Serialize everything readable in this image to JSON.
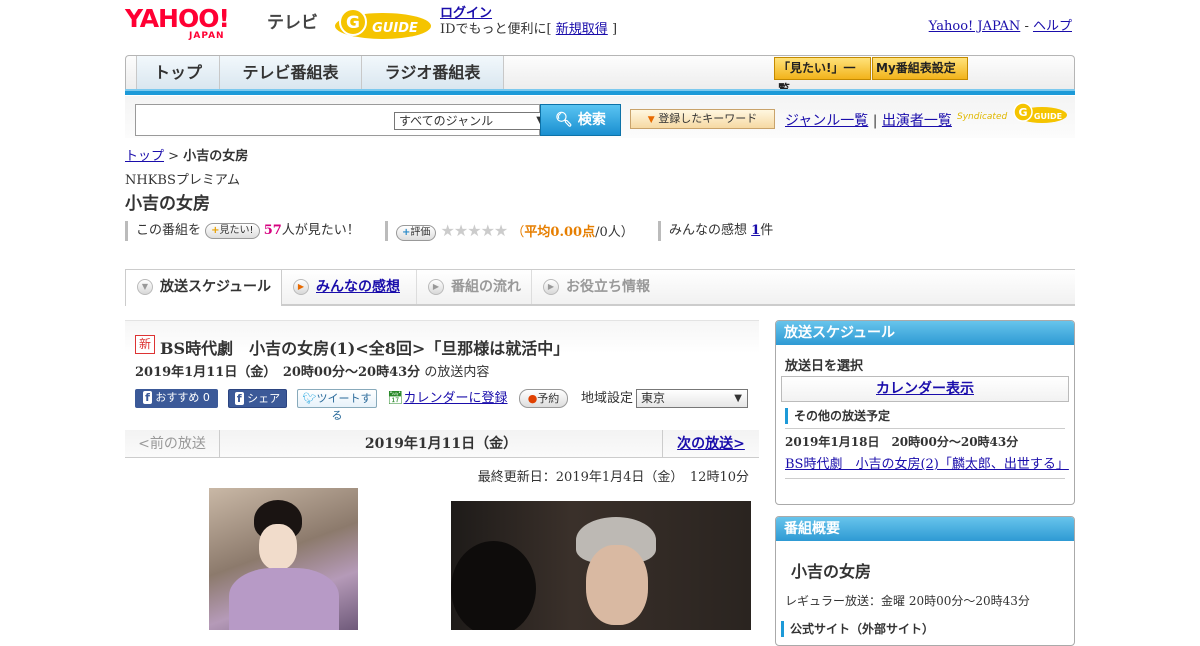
{
  "header": {
    "logo_main": "YAHOO!",
    "logo_sub": "JAPAN",
    "logo_tv": "テレビ",
    "gguide_logo": "G GUIDE",
    "login_link": "ログイン",
    "login_text": "IDでもっと便利に[",
    "register_link": "新規取得",
    "login_close": "]",
    "yj_link": "Yahoo! JAPAN",
    "sep": "-",
    "help_link": "ヘルプ"
  },
  "nav": {
    "tabs": [
      {
        "label": "トップ"
      },
      {
        "label": "テレビ番組表"
      },
      {
        "label": "ラジオ番組表"
      }
    ],
    "mitai_list": "「見たい!」一覧",
    "my_settings": "My番組表設定"
  },
  "search": {
    "genre": "すべてのジャンル",
    "button": "検索",
    "keyword_button": "登録したキーワード",
    "genre_list": "ジャンル一覧",
    "sep": "|",
    "performer_list": "出演者一覧",
    "syndicated": "Syndicated"
  },
  "breadcrumb": {
    "top": "トップ",
    "sep": ">",
    "current": "小吉の女房"
  },
  "channel": "NHKBSプレミアム",
  "program_title": "小吉の女房",
  "stats": {
    "prefix": "この番組を",
    "mitai_btn": "見たい!",
    "count": "57",
    "suffix": "人が見たい！",
    "rate_btn": "評価",
    "stars": "★★★★★",
    "open": "（",
    "avg_label": "平均",
    "avg_value": "0.00点",
    "users": "/0人）",
    "review_prefix": "みんなの感想",
    "review_count": "1",
    "review_suffix": "件"
  },
  "detail_tabs": [
    {
      "label": "放送スケジュール"
    },
    {
      "label": "みんなの感想"
    },
    {
      "label": "番組の流れ"
    },
    {
      "label": "お役立ち情報"
    }
  ],
  "episode": {
    "new_badge": "新",
    "title": "BS時代劇　小吉の女房(1)<全8回>「旦那様は就活中」",
    "date": "2019年1月11日（金）　20時00分～20時43分",
    "date_suffix": "の放送内容",
    "recommend": "おすすめ 0",
    "share": "シェア",
    "tweet": "ツイートする",
    "calendar": "カレンダーに登録",
    "reserve": "予約",
    "region_label": "地域設定",
    "region": "東京"
  },
  "pager": {
    "prev": "<前の放送",
    "current": "2019年1月11日（金）",
    "next": "次の放送>"
  },
  "updated": "最終更新日：2019年1月4日（金）　12時10分",
  "sidebar": {
    "schedule": {
      "heading": "放送スケジュール",
      "select_date": "放送日を選択",
      "calendar_btn": "カレンダー表示",
      "other_heading": "その他の放送予定",
      "next_date": "2019年1月18日　20時00分～20時43分",
      "next_title": "BS時代劇　小吉の女房(2)「麟太郎、出世する」"
    },
    "overview": {
      "heading": "番組概要",
      "title": "小吉の女房",
      "regular": "レギュラー放送：金曜 20時00分～20時43分",
      "official": "公式サイト（外部サイト）"
    }
  }
}
